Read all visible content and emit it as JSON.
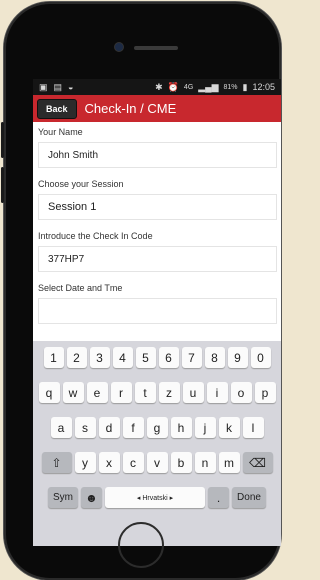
{
  "status": {
    "left_icons": [
      "image-icon",
      "calendar-icon",
      "android-icon"
    ],
    "bluetooth": "✱",
    "alarm": "⏰",
    "network": "4G",
    "battery_text": "81%",
    "time": "12:05"
  },
  "appbar": {
    "back_label": "Back",
    "title": "Check-In / CME",
    "color": "#c8282e"
  },
  "form": {
    "name_label": "Your Name",
    "name_value": "John Smith",
    "session_label": "Choose your Session",
    "session_value": "Session 1",
    "code_label": "Introduce the Check In Code",
    "code_value": "377HP7",
    "date_label": "Select Date and Tme",
    "date_value": ""
  },
  "keyboard": {
    "numbers": [
      "1",
      "2",
      "3",
      "4",
      "5",
      "6",
      "7",
      "8",
      "9",
      "0"
    ],
    "row1": [
      "q",
      "w",
      "e",
      "r",
      "t",
      "z",
      "u",
      "i",
      "o",
      "p"
    ],
    "row2": [
      "a",
      "s",
      "d",
      "f",
      "g",
      "h",
      "j",
      "k",
      "l"
    ],
    "row3": [
      "y",
      "x",
      "c",
      "v",
      "b",
      "n",
      "m"
    ],
    "shift": "⇧",
    "backspace": "⌫",
    "sym": "Sym",
    "emoji": "☻",
    "language": "◂ Hrvatski ▸",
    "period": ".",
    "done": "Done"
  }
}
